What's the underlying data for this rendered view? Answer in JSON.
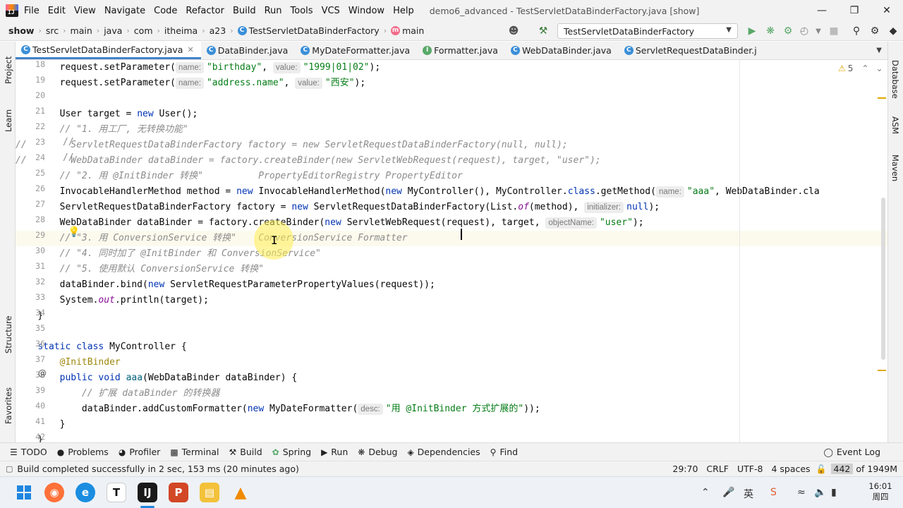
{
  "menubar": {
    "items": [
      "File",
      "Edit",
      "View",
      "Navigate",
      "Code",
      "Refactor",
      "Build",
      "Run",
      "Tools",
      "VCS",
      "Window",
      "Help"
    ],
    "title": "demo6_advanced - TestServletDataBinderFactory.java [show]"
  },
  "breadcrumb": {
    "items": [
      "show",
      "src",
      "main",
      "java",
      "com",
      "itheima",
      "a23",
      "TestServletDataBinderFactory",
      "main"
    ]
  },
  "run_config": "TestServletDataBinderFactory",
  "tabs": [
    {
      "label": "TestServletDataBinderFactory.java",
      "icon": "C",
      "active": true
    },
    {
      "label": "DataBinder.java",
      "icon": "C"
    },
    {
      "label": "MyDateFormatter.java",
      "icon": "C"
    },
    {
      "label": "Formatter.java",
      "icon": "I"
    },
    {
      "label": "WebDataBinder.java",
      "icon": "C"
    },
    {
      "label": "ServletRequestDataBinder.j",
      "icon": "C"
    }
  ],
  "left_tools": [
    "Project",
    "Learn",
    "Structure",
    "Favorites"
  ],
  "right_tools": [
    "Database",
    "ASM",
    "Maven"
  ],
  "warnings_count": "5",
  "code": {
    "line_numbers": [
      "18",
      "19",
      "20",
      "21",
      "22",
      "23",
      "24",
      "25",
      "26",
      "27",
      "28",
      "29",
      "30",
      "31",
      "32",
      "33",
      "34",
      "35",
      "36",
      "37",
      "38",
      "39",
      "40",
      "41",
      "42"
    ],
    "lines": {
      "l18_a": "        request.setParameter(",
      "l18_hint1": "name:",
      "l18_s1": "\"birthday\"",
      "l18_hint2": "value:",
      "l18_s2": "\"1999|01|02\"",
      "l18_end": ");",
      "l19_a": "        request.setParameter(",
      "l19_hint1": "name:",
      "l19_s1": "\"address.name\"",
      "l19_hint2": "value:",
      "l19_s2": "\"西安\"",
      "l19_end": ");",
      "l21": "        User target = ",
      "l21_kw": "new",
      "l21_end": " User();",
      "l22": "        // \"1. 用工厂, 无转换功能\"",
      "l23": "//        ServletRequestDataBinderFactory factory = new ServletRequestDataBinderFactory(null, null);",
      "l24": "//        WebDataBinder dataBinder = factory.createBinder(new ServletWebRequest(request), target, \"user\");",
      "l25": "        // \"2. 用 @InitBinder 转换\"          PropertyEditorRegistry PropertyEditor",
      "l26_a": "        InvocableHandlerMethod method = ",
      "l26_kw1": "new",
      "l26_b": " InvocableHandlerMethod(",
      "l26_kw2": "new",
      "l26_c": " MyController(), MyController.",
      "l26_kw3": "class",
      "l26_d": ".getMethod(",
      "l26_hint": "name:",
      "l26_s": "\"aaa\"",
      "l26_e": ", WebDataBinder.cla",
      "l27_a": "        ServletRequestDataBinderFactory factory = ",
      "l27_kw": "new",
      "l27_b": " ServletRequestDataBinderFactory(List.",
      "l27_st": "of",
      "l27_c": "(method), ",
      "l27_hint": "initializer:",
      "l27_kw2": "null",
      "l27_d": ");",
      "l28_a": "        WebDataBinder dataBinder = factory.createBinder(",
      "l28_kw": "new",
      "l28_b": " ServletWebRequest(request), target, ",
      "l28_hint": "objectName:",
      "l28_s": "\"user\"",
      "l28_c": ");",
      "l29": "        // \"3. 用 ConversionService 转换\"    ConversionService Formatter",
      "l30": "        // \"4. 同时加了 @InitBinder 和 ConversionService\"",
      "l31": "        // \"5. 使用默认 ConversionService 转换\"",
      "l32_a": "        dataBinder.bind(",
      "l32_kw": "new",
      "l32_b": " ServletRequestParameterPropertyValues(request));",
      "l33_a": "        System.",
      "l33_st": "out",
      "l33_b": ".println(target);",
      "l34": "    }",
      "l36_kw1": "static",
      "l36_kw2": "class",
      "l36_a": " MyController {",
      "l37_ann": "@InitBinder",
      "l38_kw1": "public",
      "l38_kw2": "void",
      "l38_fn": "aaa",
      "l38_a": "(WebDataBinder dataBinder) {",
      "l39": "            // 扩展 dataBinder 的转换器",
      "l40_a": "            dataBinder.addCustomFormatter(",
      "l40_kw": "new",
      "l40_b": " MyDateFormatter(",
      "l40_hint": "desc:",
      "l40_s": "\"用 @InitBinder 方式扩展的\"",
      "l40_c": "));",
      "l41": "        }",
      "l42": "    }"
    },
    "line_comment_marks": [
      "//",
      "//"
    ]
  },
  "bottom_tools": [
    "TODO",
    "Problems",
    "Profiler",
    "Terminal",
    "Build",
    "Spring",
    "Run",
    "Debug",
    "Dependencies",
    "Find"
  ],
  "event_log": "Event Log",
  "status": {
    "message": "Build completed successfully in 2 sec, 153 ms (20 minutes ago)",
    "position": "29:70",
    "line_sep": "CRLF",
    "encoding": "UTF-8",
    "indent": "4 spaces",
    "memory_used": "442",
    "memory_total": "of 1949M"
  },
  "clock": {
    "time": "16:01",
    "day": "周四"
  },
  "colors": {
    "keyword": "#0033b3",
    "string": "#067d17",
    "comment": "#8c8c8c",
    "annotation": "#9e880d",
    "accent": "#4083c9",
    "run_green": "#59a869"
  }
}
